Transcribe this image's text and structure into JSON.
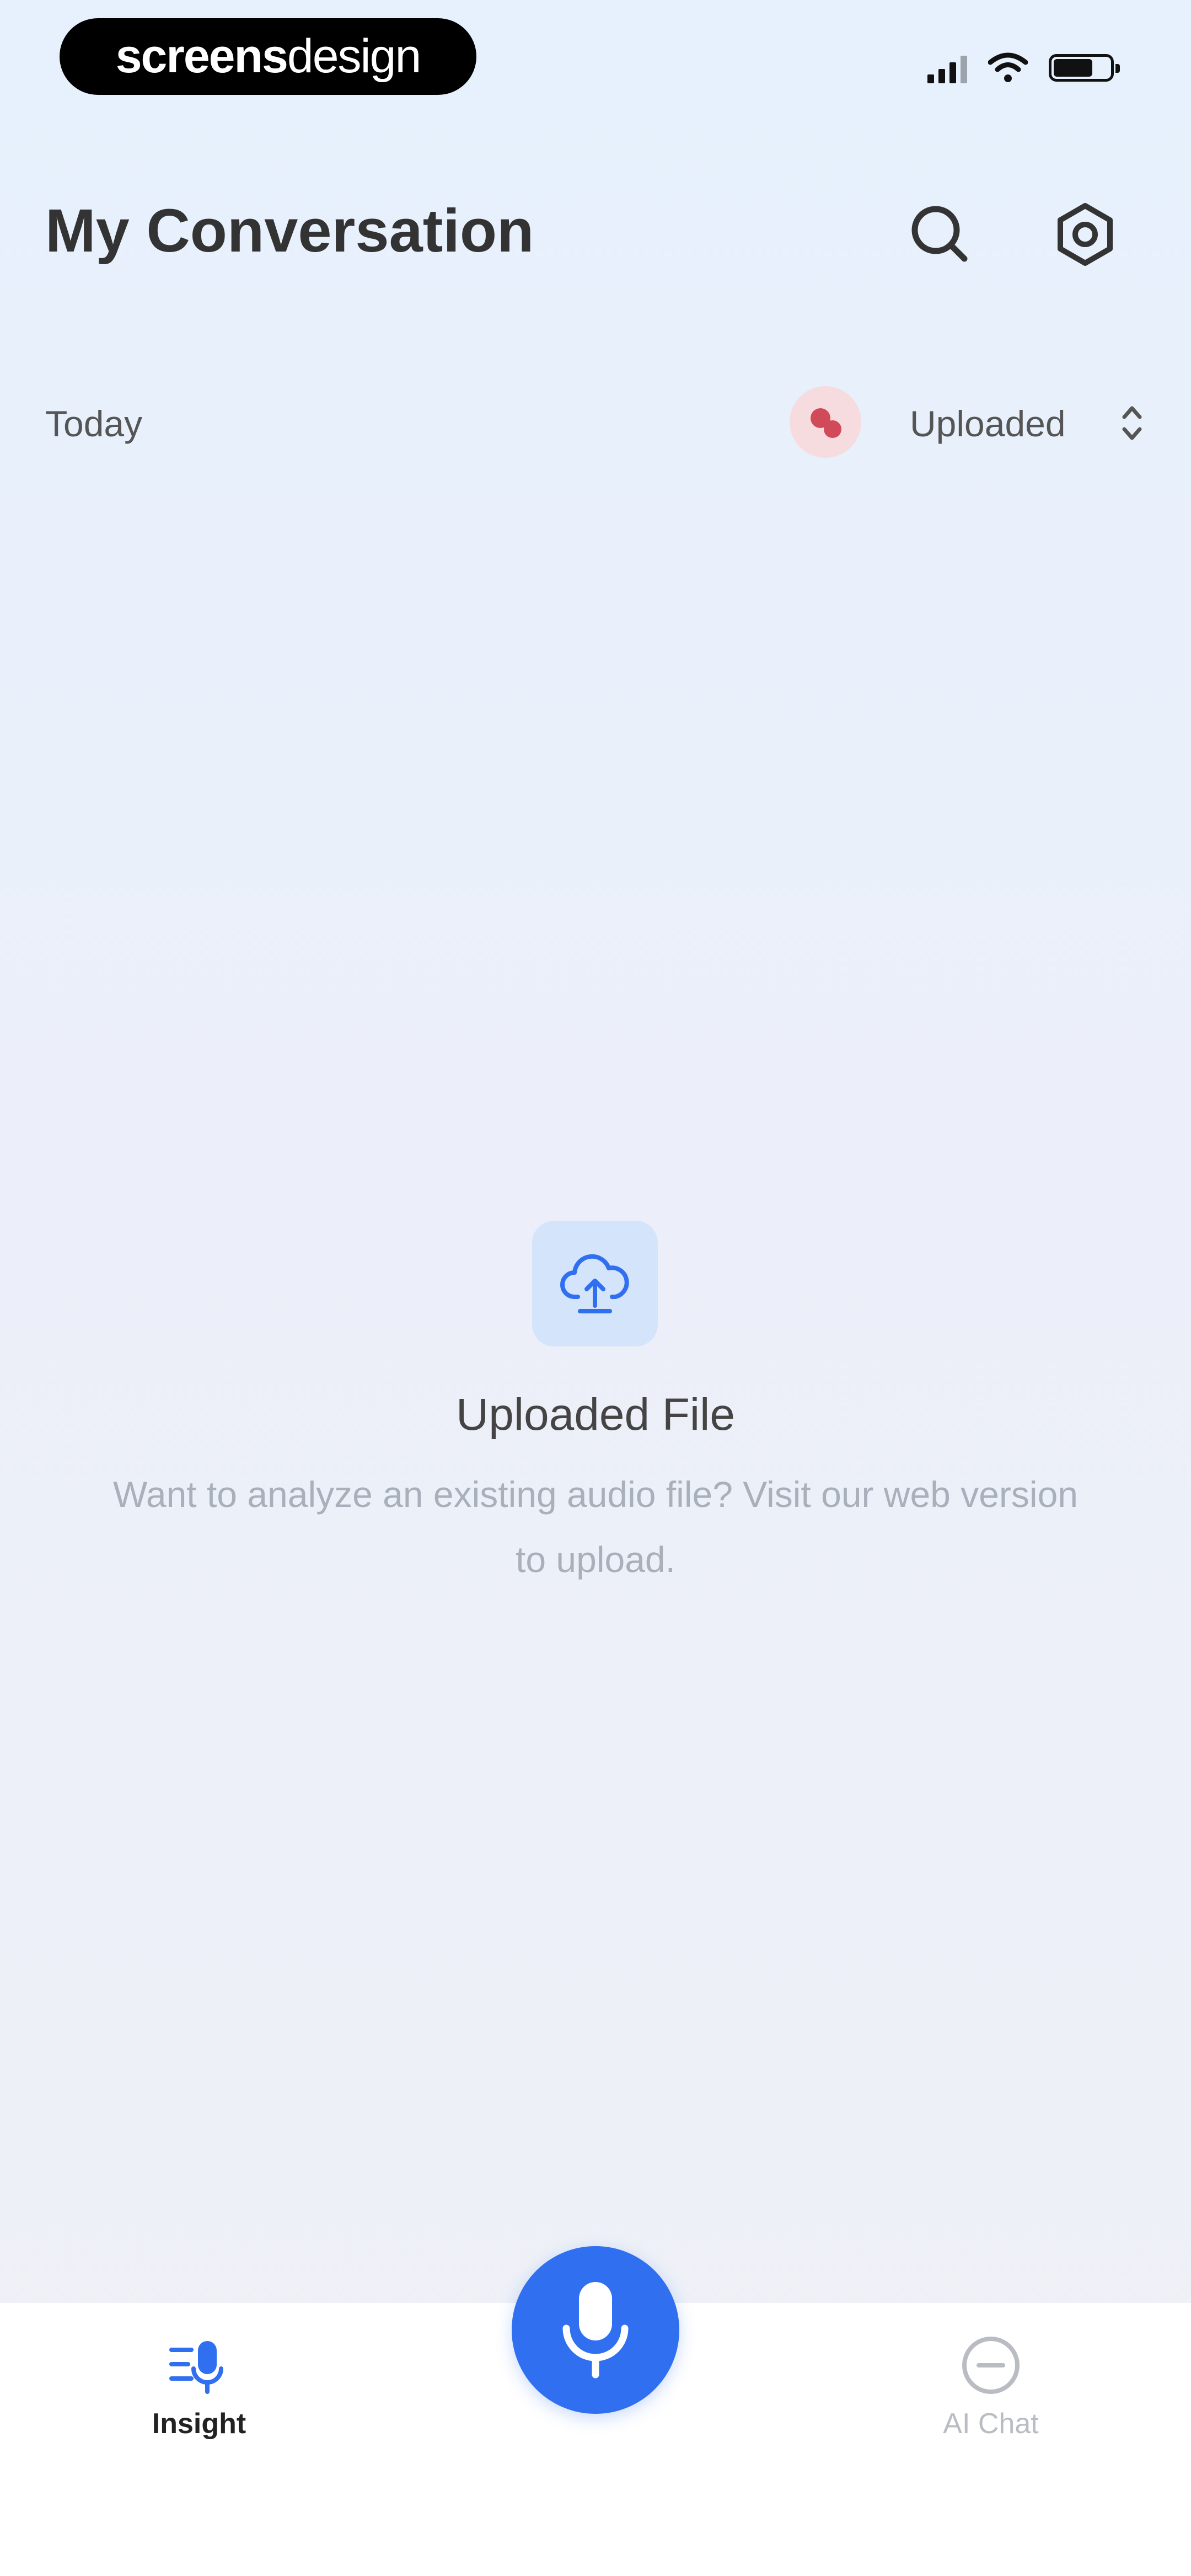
{
  "watermark": {
    "part1": "screens",
    "part2": "design"
  },
  "header": {
    "title": "My Conversation",
    "search_icon": "search-icon",
    "settings_icon": "settings-hexagon-icon"
  },
  "filter": {
    "date_label": "Today",
    "badge_icon": "record-badge-icon",
    "sort_label": "Uploaded",
    "sort_icon": "sort-arrows-icon"
  },
  "empty_state": {
    "icon": "cloud-upload-icon",
    "title": "Uploaded File",
    "description": "Want to analyze an existing audio file? Visit our web version to upload."
  },
  "tabbar": {
    "tabs": [
      {
        "label": "Insight",
        "icon": "insight-mic-icon",
        "active": true
      },
      {
        "label": "AI Chat",
        "icon": "chat-bubble-icon",
        "active": false
      }
    ],
    "center_button_icon": "microphone-icon"
  },
  "colors": {
    "accent": "#2f6ff0",
    "badge_bg": "#f7dcdf",
    "badge_fg": "#d04a5a",
    "upload_bg": "#d4e4fb"
  }
}
